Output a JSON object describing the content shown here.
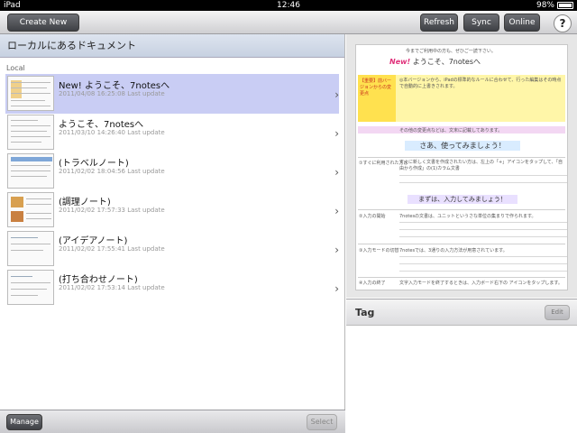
{
  "status_bar": {
    "device": "iPad",
    "time": "12:46",
    "battery": "98%"
  },
  "toolbar": {
    "create_new_label": "Create New",
    "refresh_label": "Refresh",
    "sync_label": "Sync",
    "online_label": "Online",
    "help_label": "?"
  },
  "left_pane": {
    "title": "ローカルにあるドキュメント",
    "section_label": "Local",
    "documents": [
      {
        "title": "New! ようこそ、7notesへ",
        "date": "2011/04/08 16:25:08 Last update",
        "selected": true
      },
      {
        "title": "ようこそ、7notesへ",
        "date": "2011/03/10 14:26:40 Last update",
        "selected": false
      },
      {
        "title": "(トラベルノート)",
        "date": "2011/02/02 18:04:56 Last update",
        "selected": false
      },
      {
        "title": "(調理ノート)",
        "date": "2011/02/02 17:57:33 Last update",
        "selected": false
      },
      {
        "title": "(アイデアノート)",
        "date": "2011/02/02 17:55:41 Last update",
        "selected": false
      },
      {
        "title": "(打ち合わせノート)",
        "date": "2011/02/02 17:53:14 Last update",
        "selected": false
      }
    ],
    "manage_label": "Manage",
    "select_label": "Select"
  },
  "preview": {
    "top_line": "今までご利用中の方も、ぜひご一読下さい。",
    "welcome_new": "New!",
    "welcome_rest": "ようこそ、7notesへ",
    "side_label": "【重要】前バージョンからの変更点",
    "yellow_text": "◎本バージョンから、iPadの標準的なルールに合わせて、行った編集はその時点で自動的に上書きされます。",
    "pink_text": "その他の変更点などは、文末に記載してあります。",
    "heading1": "さあ、使ってみましょう！",
    "heading2": "まずは、入力してみましょう！",
    "labels": [
      "①すぐに利用された方は",
      "②入力の開始",
      "③入力モードの切替",
      "④入力の終了"
    ],
    "row_texts": [
      "すぐに新しく文書を作成されたい方は、左上の「+」アイコンをタップして、「自由から作成」の(1)カラム文書",
      "7notesの文書は、ユニットというさな単位の集まりで作られます。",
      "7notesでは、3通りの入力方法が用意されています。",
      "文字入力モードを終了するときは、入力ボード右下の アイコンをタップします。"
    ]
  },
  "tag": {
    "label": "Tag",
    "edit_label": "Edit"
  }
}
